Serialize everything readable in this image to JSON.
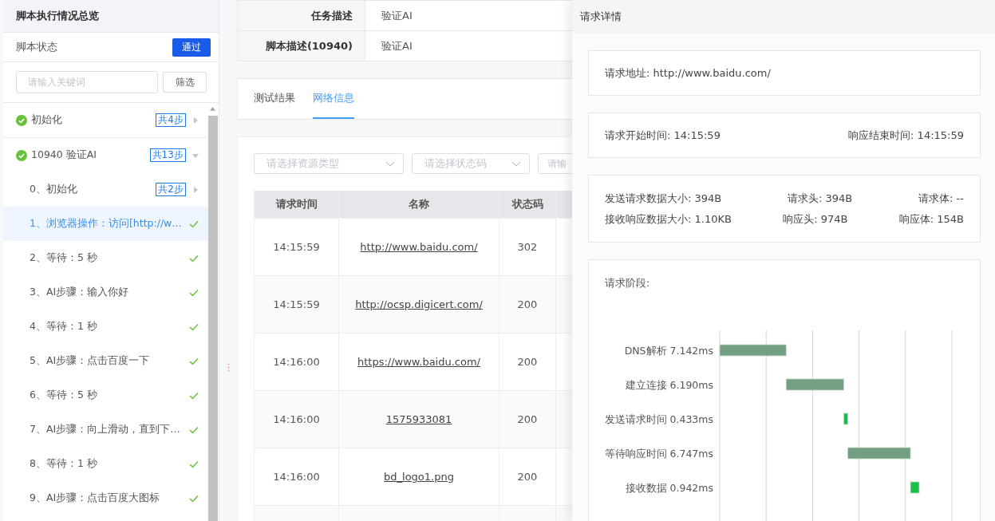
{
  "sidebar": {
    "title": "脚本执行情况总览",
    "status_label": "脚本状态",
    "status_badge": "通过",
    "search": {
      "placeholder": "请输入关键词"
    },
    "filter_button": "筛选",
    "steps": [
      {
        "label": "初始化",
        "badge": "共4步",
        "expanded": false,
        "passed": true,
        "selected": false
      },
      {
        "label": "10940 验证AI",
        "badge": "共13步",
        "expanded": true,
        "passed": true,
        "selected": false,
        "children": [
          {
            "label": "0、初始化",
            "badge": "共2步",
            "expanded": false,
            "selected": false
          },
          {
            "label": "1、浏览器操作：访问[http://w…",
            "passed": true,
            "selected": true
          },
          {
            "label": "2、等待：5 秒",
            "passed": true,
            "selected": false
          },
          {
            "label": "3、AI步骤：输入你好",
            "passed": true,
            "selected": false
          },
          {
            "label": "4、等待：1 秒",
            "passed": true,
            "selected": false
          },
          {
            "label": "5、AI步骤：点击百度一下",
            "passed": true,
            "selected": false
          },
          {
            "label": "6、等待：5 秒",
            "passed": true,
            "selected": false
          },
          {
            "label": "7、AI步骤：向上滑动，直到下…",
            "passed": true,
            "selected": false
          },
          {
            "label": "8、等待：1 秒",
            "passed": true,
            "selected": false
          },
          {
            "label": "9、AI步骤：点击百度大图标",
            "passed": true,
            "selected": false
          }
        ]
      }
    ]
  },
  "info": [
    {
      "label": "任务描述",
      "value": "验证AI"
    },
    {
      "label": "脚本描述(10940)",
      "value": "验证AI"
    }
  ],
  "tabs": [
    {
      "label": "测试结果",
      "selected": false
    },
    {
      "label": "网络信息",
      "selected": true
    }
  ],
  "filters": [
    {
      "placeholder": "请选择资源类型",
      "kind": "select"
    },
    {
      "placeholder": "请选择状态码",
      "kind": "select"
    },
    {
      "placeholder": "请输",
      "kind": "input"
    }
  ],
  "table": {
    "columns": [
      "请求时间",
      "名称",
      "状态码"
    ],
    "rows": [
      [
        "14:15:59",
        "http://www.baidu.com/",
        "302"
      ],
      [
        "14:15:59",
        "http://ocsp.digicert.com/",
        "200"
      ],
      [
        "14:16:00",
        "https://www.baidu.com/",
        "200"
      ],
      [
        "14:16:00",
        "1575933081",
        "200"
      ],
      [
        "14:16:00",
        "bd_logo1.png",
        "200"
      ],
      [
        "",
        "",
        ""
      ]
    ]
  },
  "drawer": {
    "title": "请求详情",
    "url_line": "请求地址: http://www.baidu.com/",
    "start_time": "请求开始时间: 14:15:59",
    "end_time": "响应结束时间: 14:15:59",
    "sizes": [
      [
        "发送请求数据大小: 394B",
        "请求头: 394B",
        "请求体: --"
      ],
      [
        "接收响应数据大小: 1.10KB",
        "响应头: 974B",
        "响应体: 154B"
      ]
    ],
    "phases_title": "请求阶段:",
    "phases": [
      "DNS解析 7.142ms",
      "建立连接 6.190ms",
      "发送请求时间 0.433ms",
      "等待响应时间 6.747ms",
      "接收数据 0.942ms"
    ]
  }
}
